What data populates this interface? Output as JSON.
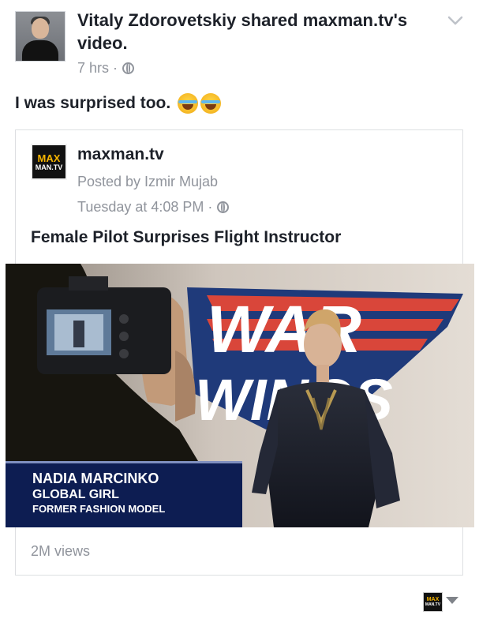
{
  "post": {
    "author_line": "Vitaly Zdorovetskiy shared maxman.tv's video.",
    "time": "7 hrs ·",
    "privacy_icon": "globe-icon",
    "menu_icon": "chevron-down-icon",
    "status_text": "I was surprised too.",
    "status_emoji": [
      "face-with-tears-of-joy",
      "face-with-tears-of-joy"
    ]
  },
  "shared": {
    "logo_line1": "MAX",
    "logo_line2": "MAN.TV",
    "page_name": "maxman.tv",
    "posted_by": "Posted by Izmir Mujab",
    "time": "Tuesday at 4:08 PM ·",
    "title": "Female Pilot Surprises Flight Instructor",
    "views": "2M views"
  },
  "video": {
    "backdrop_text_1": "WAR",
    "backdrop_text_2": "WINGS",
    "lower_third": {
      "name": "NADIA MARCINKO",
      "line2": "GLOBAL GIRL",
      "line3": "FORMER FASHION MODEL"
    },
    "camera_brand": "",
    "colors": {
      "stripe_red": "#d9463a",
      "stripe_navy": "#1f3a7a",
      "lower_third_navy": "#0d1d52"
    }
  },
  "footer": {
    "logo_line1": "MAX",
    "logo_line2": "MAN.TV",
    "caret_icon": "caret-down-icon"
  }
}
